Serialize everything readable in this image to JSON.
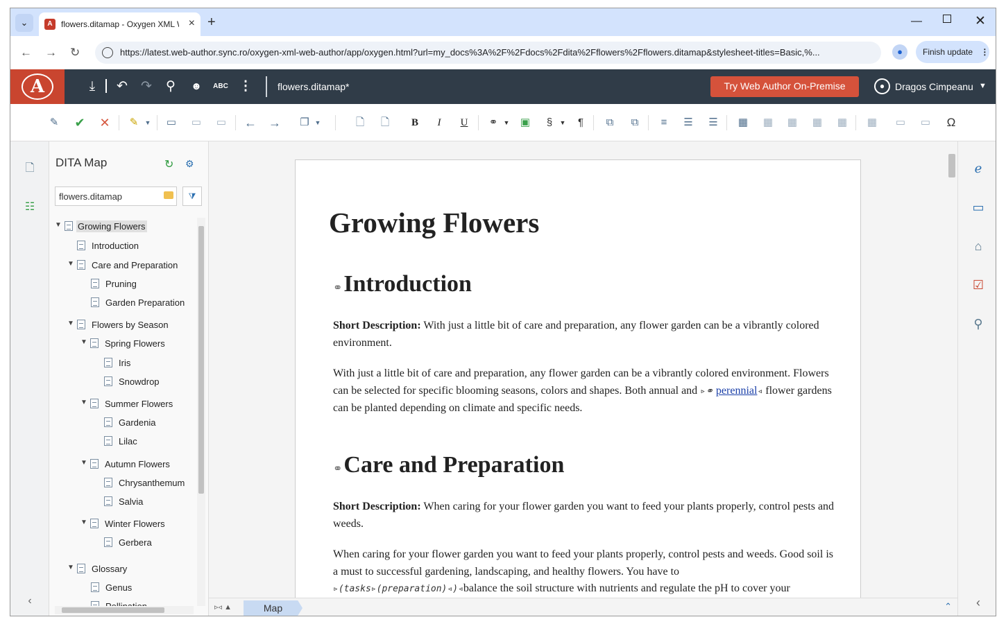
{
  "browser": {
    "tab_title": "flowers.ditamap - Oxygen XML Web Author",
    "url": "https://latest.web-author.sync.ro/oxygen-xml-web-author/app/oxygen.html?url=my_docs%3A%2F%2Fdocs%2Fdita%2Fflowers%2Fflowers.ditamap&stylesheet-titles=Basic,%...",
    "finish_update_label": "Finish update"
  },
  "header": {
    "document_title": "flowers.ditamap*",
    "try_button_label": "Try Web Author On-Premise",
    "user_name": "Dragos Cimpeanu"
  },
  "map_panel": {
    "title": "DITA Map",
    "map_file": "flowers.ditamap",
    "tree": [
      {
        "label": "Growing Flowers",
        "expanded": true,
        "selected": true
      },
      {
        "label": "Introduction"
      },
      {
        "label": "Care and Preparation",
        "expanded": true
      },
      {
        "label": "Pruning"
      },
      {
        "label": "Garden Preparation"
      },
      {
        "label": "Flowers by Season",
        "expanded": true
      },
      {
        "label": "Spring Flowers",
        "expanded": true
      },
      {
        "label": "Iris"
      },
      {
        "label": "Snowdrop"
      },
      {
        "label": "Summer Flowers",
        "expanded": true
      },
      {
        "label": "Gardenia"
      },
      {
        "label": "Lilac"
      },
      {
        "label": "Autumn Flowers",
        "expanded": true
      },
      {
        "label": "Chrysanthemum"
      },
      {
        "label": "Salvia"
      },
      {
        "label": "Winter Flowers",
        "expanded": true
      },
      {
        "label": "Gerbera"
      },
      {
        "label": "Glossary",
        "expanded": true
      },
      {
        "label": "Genus"
      },
      {
        "label": "Pollination"
      }
    ]
  },
  "document": {
    "title": "Growing Flowers",
    "sections": [
      {
        "heading": "Introduction",
        "short_desc_label": "Short Description:",
        "short_desc": "With just a little bit of care and preparation, any flower garden can be a vibrantly colored environment.",
        "body_before": "With just a little bit of care and preparation, any flower garden can be a vibrantly colored environment. Flowers can be selected for specific blooming seasons, colors and shapes. Both annual and",
        "body_link": "perennial",
        "body_after": "flower gardens can be planted depending on climate and specific needs."
      },
      {
        "heading": "Care and Preparation",
        "short_desc_label": "Short Description:",
        "short_desc": "When caring for your flower garden you want to feed your plants properly, control pests and weeds.",
        "body_line1": "When caring for your flower garden you want to feed your plants properly, control pests and weeds. Good soil is a must to successful gardening, landscaping, and healthy flowers. You have to",
        "tag_open_1": "(tasks",
        "tag_open_2": "(preparation)",
        "tag_close": ")",
        "body_line3": "balance the soil structure with nutrients and regulate the pH to cover your"
      }
    ]
  },
  "bottom_bar": {
    "tab_label": "Map"
  }
}
